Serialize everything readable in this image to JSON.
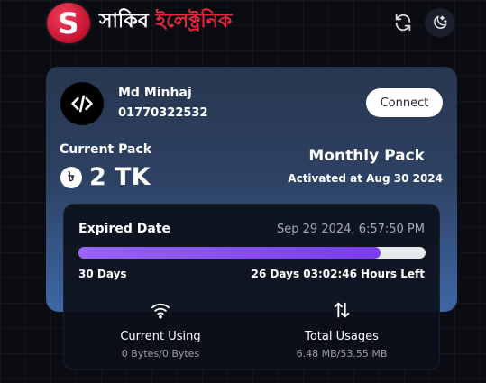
{
  "header": {
    "logo_letter": "S",
    "brand_part1": "সাকিব",
    "brand_part2": "ইলেক্ট্রনিক",
    "refresh_icon": "refresh-icon",
    "theme_icon": "moon-stars-icon"
  },
  "colors": {
    "accent_red": "#e8283c",
    "progress_purple": "#7a3cf0"
  },
  "user": {
    "avatar_icon": "code-icon",
    "name": "Md Minhaj",
    "phone": "01770322532",
    "connect_label": "Connect"
  },
  "pack": {
    "label": "Current Pack",
    "currency_symbol": "৳",
    "amount": "2 TK",
    "type": "Monthly Pack",
    "activated": "Activated at Aug 30 2024"
  },
  "expiry": {
    "label": "Expired Date",
    "date": "Sep 29 2024, 6:57:50 PM",
    "progress_percent": 87,
    "total_days": "30 Days",
    "time_left": "26 Days 03:02:46 Hours Left"
  },
  "stats": {
    "current": {
      "icon": "wifi-icon",
      "title": "Current Using",
      "value": "0 Bytes/0 Bytes"
    },
    "total": {
      "icon": "transfer-arrows-icon",
      "title": "Total Usages",
      "value": "6.48 MB/53.55 MB"
    }
  }
}
